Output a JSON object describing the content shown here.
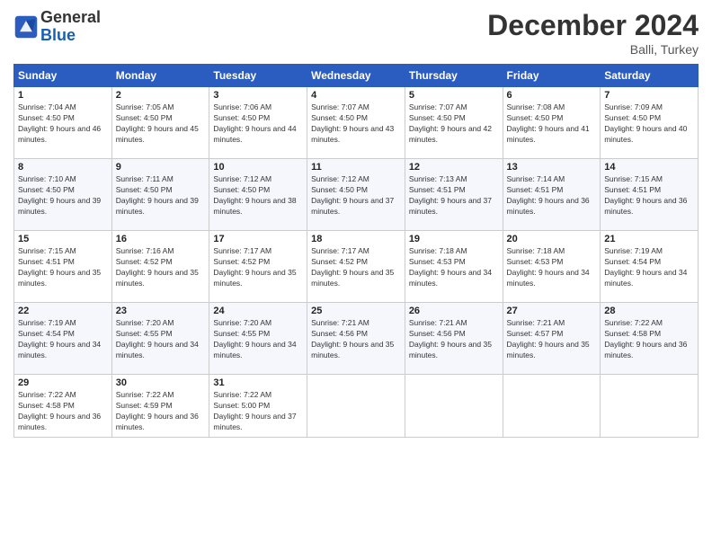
{
  "header": {
    "logo_general": "General",
    "logo_blue": "Blue",
    "month_title": "December 2024",
    "location": "Balli, Turkey"
  },
  "days_of_week": [
    "Sunday",
    "Monday",
    "Tuesday",
    "Wednesday",
    "Thursday",
    "Friday",
    "Saturday"
  ],
  "weeks": [
    [
      {
        "day": "1",
        "sunrise": "Sunrise: 7:04 AM",
        "sunset": "Sunset: 4:50 PM",
        "daylight": "Daylight: 9 hours and 46 minutes."
      },
      {
        "day": "2",
        "sunrise": "Sunrise: 7:05 AM",
        "sunset": "Sunset: 4:50 PM",
        "daylight": "Daylight: 9 hours and 45 minutes."
      },
      {
        "day": "3",
        "sunrise": "Sunrise: 7:06 AM",
        "sunset": "Sunset: 4:50 PM",
        "daylight": "Daylight: 9 hours and 44 minutes."
      },
      {
        "day": "4",
        "sunrise": "Sunrise: 7:07 AM",
        "sunset": "Sunset: 4:50 PM",
        "daylight": "Daylight: 9 hours and 43 minutes."
      },
      {
        "day": "5",
        "sunrise": "Sunrise: 7:07 AM",
        "sunset": "Sunset: 4:50 PM",
        "daylight": "Daylight: 9 hours and 42 minutes."
      },
      {
        "day": "6",
        "sunrise": "Sunrise: 7:08 AM",
        "sunset": "Sunset: 4:50 PM",
        "daylight": "Daylight: 9 hours and 41 minutes."
      },
      {
        "day": "7",
        "sunrise": "Sunrise: 7:09 AM",
        "sunset": "Sunset: 4:50 PM",
        "daylight": "Daylight: 9 hours and 40 minutes."
      }
    ],
    [
      {
        "day": "8",
        "sunrise": "Sunrise: 7:10 AM",
        "sunset": "Sunset: 4:50 PM",
        "daylight": "Daylight: 9 hours and 39 minutes."
      },
      {
        "day": "9",
        "sunrise": "Sunrise: 7:11 AM",
        "sunset": "Sunset: 4:50 PM",
        "daylight": "Daylight: 9 hours and 39 minutes."
      },
      {
        "day": "10",
        "sunrise": "Sunrise: 7:12 AM",
        "sunset": "Sunset: 4:50 PM",
        "daylight": "Daylight: 9 hours and 38 minutes."
      },
      {
        "day": "11",
        "sunrise": "Sunrise: 7:12 AM",
        "sunset": "Sunset: 4:50 PM",
        "daylight": "Daylight: 9 hours and 37 minutes."
      },
      {
        "day": "12",
        "sunrise": "Sunrise: 7:13 AM",
        "sunset": "Sunset: 4:51 PM",
        "daylight": "Daylight: 9 hours and 37 minutes."
      },
      {
        "day": "13",
        "sunrise": "Sunrise: 7:14 AM",
        "sunset": "Sunset: 4:51 PM",
        "daylight": "Daylight: 9 hours and 36 minutes."
      },
      {
        "day": "14",
        "sunrise": "Sunrise: 7:15 AM",
        "sunset": "Sunset: 4:51 PM",
        "daylight": "Daylight: 9 hours and 36 minutes."
      }
    ],
    [
      {
        "day": "15",
        "sunrise": "Sunrise: 7:15 AM",
        "sunset": "Sunset: 4:51 PM",
        "daylight": "Daylight: 9 hours and 35 minutes."
      },
      {
        "day": "16",
        "sunrise": "Sunrise: 7:16 AM",
        "sunset": "Sunset: 4:52 PM",
        "daylight": "Daylight: 9 hours and 35 minutes."
      },
      {
        "day": "17",
        "sunrise": "Sunrise: 7:17 AM",
        "sunset": "Sunset: 4:52 PM",
        "daylight": "Daylight: 9 hours and 35 minutes."
      },
      {
        "day": "18",
        "sunrise": "Sunrise: 7:17 AM",
        "sunset": "Sunset: 4:52 PM",
        "daylight": "Daylight: 9 hours and 35 minutes."
      },
      {
        "day": "19",
        "sunrise": "Sunrise: 7:18 AM",
        "sunset": "Sunset: 4:53 PM",
        "daylight": "Daylight: 9 hours and 34 minutes."
      },
      {
        "day": "20",
        "sunrise": "Sunrise: 7:18 AM",
        "sunset": "Sunset: 4:53 PM",
        "daylight": "Daylight: 9 hours and 34 minutes."
      },
      {
        "day": "21",
        "sunrise": "Sunrise: 7:19 AM",
        "sunset": "Sunset: 4:54 PM",
        "daylight": "Daylight: 9 hours and 34 minutes."
      }
    ],
    [
      {
        "day": "22",
        "sunrise": "Sunrise: 7:19 AM",
        "sunset": "Sunset: 4:54 PM",
        "daylight": "Daylight: 9 hours and 34 minutes."
      },
      {
        "day": "23",
        "sunrise": "Sunrise: 7:20 AM",
        "sunset": "Sunset: 4:55 PM",
        "daylight": "Daylight: 9 hours and 34 minutes."
      },
      {
        "day": "24",
        "sunrise": "Sunrise: 7:20 AM",
        "sunset": "Sunset: 4:55 PM",
        "daylight": "Daylight: 9 hours and 34 minutes."
      },
      {
        "day": "25",
        "sunrise": "Sunrise: 7:21 AM",
        "sunset": "Sunset: 4:56 PM",
        "daylight": "Daylight: 9 hours and 35 minutes."
      },
      {
        "day": "26",
        "sunrise": "Sunrise: 7:21 AM",
        "sunset": "Sunset: 4:56 PM",
        "daylight": "Daylight: 9 hours and 35 minutes."
      },
      {
        "day": "27",
        "sunrise": "Sunrise: 7:21 AM",
        "sunset": "Sunset: 4:57 PM",
        "daylight": "Daylight: 9 hours and 35 minutes."
      },
      {
        "day": "28",
        "sunrise": "Sunrise: 7:22 AM",
        "sunset": "Sunset: 4:58 PM",
        "daylight": "Daylight: 9 hours and 36 minutes."
      }
    ],
    [
      {
        "day": "29",
        "sunrise": "Sunrise: 7:22 AM",
        "sunset": "Sunset: 4:58 PM",
        "daylight": "Daylight: 9 hours and 36 minutes."
      },
      {
        "day": "30",
        "sunrise": "Sunrise: 7:22 AM",
        "sunset": "Sunset: 4:59 PM",
        "daylight": "Daylight: 9 hours and 36 minutes."
      },
      {
        "day": "31",
        "sunrise": "Sunrise: 7:22 AM",
        "sunset": "Sunset: 5:00 PM",
        "daylight": "Daylight: 9 hours and 37 minutes."
      },
      null,
      null,
      null,
      null
    ]
  ]
}
